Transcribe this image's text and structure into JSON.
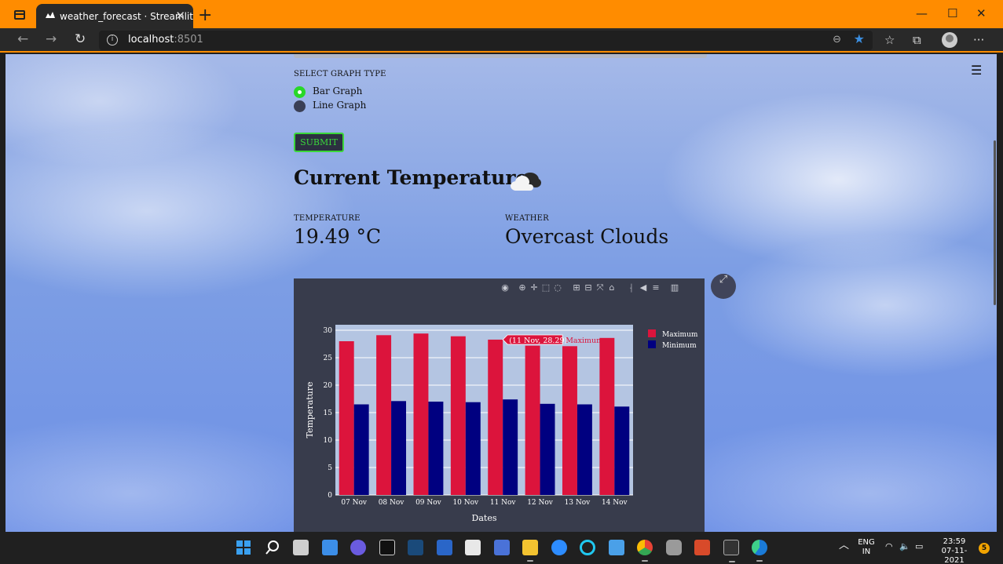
{
  "browser": {
    "tab_title": "weather_forecast · Streamlit",
    "tab_close": "✕",
    "new_tab": "+",
    "url_host": "localhost",
    "url_port": ":8501",
    "window_controls": {
      "minimize": "—",
      "maximize": "☐",
      "close": "✕"
    }
  },
  "page": {
    "graph_type_label": "SELECT GRAPH TYPE",
    "graph_options": [
      {
        "label": "Bar Graph",
        "selected": true
      },
      {
        "label": "Line Graph",
        "selected": false
      }
    ],
    "submit_label": "SUBMIT",
    "current_heading": "Current Temperature",
    "temperature_label": "TEMPERATURE",
    "temperature_value": "19.49 °C",
    "weather_label": "WEATHER",
    "weather_value": "Overcast Clouds",
    "menu_glyph": "☰"
  },
  "chart_data": {
    "type": "bar",
    "categories": [
      "07 Nov",
      "08 Nov",
      "09 Nov",
      "10 Nov",
      "11 Nov",
      "12 Nov",
      "13 Nov",
      "14 Nov"
    ],
    "series": [
      {
        "name": "Maximum",
        "color": "#dc143c",
        "values": [
          28.0,
          29.1,
          29.4,
          28.9,
          28.29,
          27.2,
          27.1,
          28.6
        ]
      },
      {
        "name": "Minimum",
        "color": "#000080",
        "values": [
          16.5,
          17.1,
          17.0,
          16.9,
          17.4,
          16.6,
          16.5,
          16.1
        ]
      }
    ],
    "xlabel": "Dates",
    "ylabel": "Temperature",
    "ylim": [
      0,
      31
    ],
    "yticks": [
      0,
      5,
      10,
      15,
      20,
      25,
      30
    ],
    "grid": true,
    "legend_position": "top-right",
    "hover_label": {
      "text": "(11 Nov, 28.29)",
      "series": "Maximum",
      "category": "11 Nov",
      "value": 28.29
    }
  },
  "taskbar": {
    "lang_primary": "ENG",
    "lang_secondary": "IN",
    "time": "23:59",
    "date": "07-11-2021",
    "notifications": "5"
  }
}
